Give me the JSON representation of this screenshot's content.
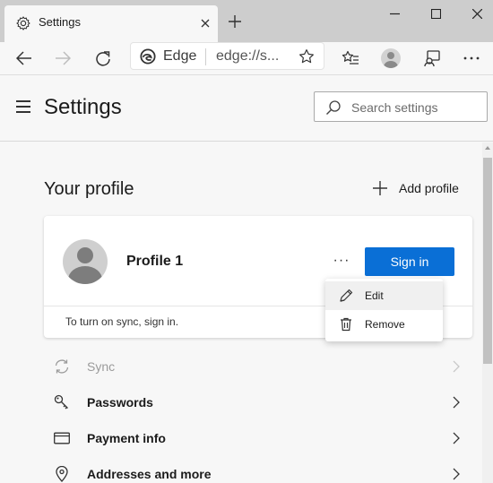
{
  "tab": {
    "title": "Settings"
  },
  "address": {
    "site_label": "Edge",
    "url": "edge://s..."
  },
  "header": {
    "title": "Settings",
    "search_placeholder": "Search settings"
  },
  "profile": {
    "section_title": "Your profile",
    "add_profile_label": "Add profile",
    "name": "Profile 1",
    "more_label": "···",
    "sign_in_label": "Sign in",
    "sync_hint": "To turn on sync, sign in."
  },
  "menu": {
    "items": [
      {
        "label": "Edit",
        "icon": "pencil-icon"
      },
      {
        "label": "Remove",
        "icon": "trash-icon"
      }
    ]
  },
  "rows": [
    {
      "label": "Sync",
      "icon": "sync-icon",
      "disabled": true
    },
    {
      "label": "Passwords",
      "icon": "key-icon",
      "disabled": false
    },
    {
      "label": "Payment info",
      "icon": "credit-card-icon",
      "disabled": false
    },
    {
      "label": "Addresses and more",
      "icon": "location-pin-icon",
      "disabled": false
    }
  ],
  "colors": {
    "accent": "#0a6fd6",
    "titlebar": "#cdcdcd",
    "page_bg": "#f7f7f7"
  }
}
